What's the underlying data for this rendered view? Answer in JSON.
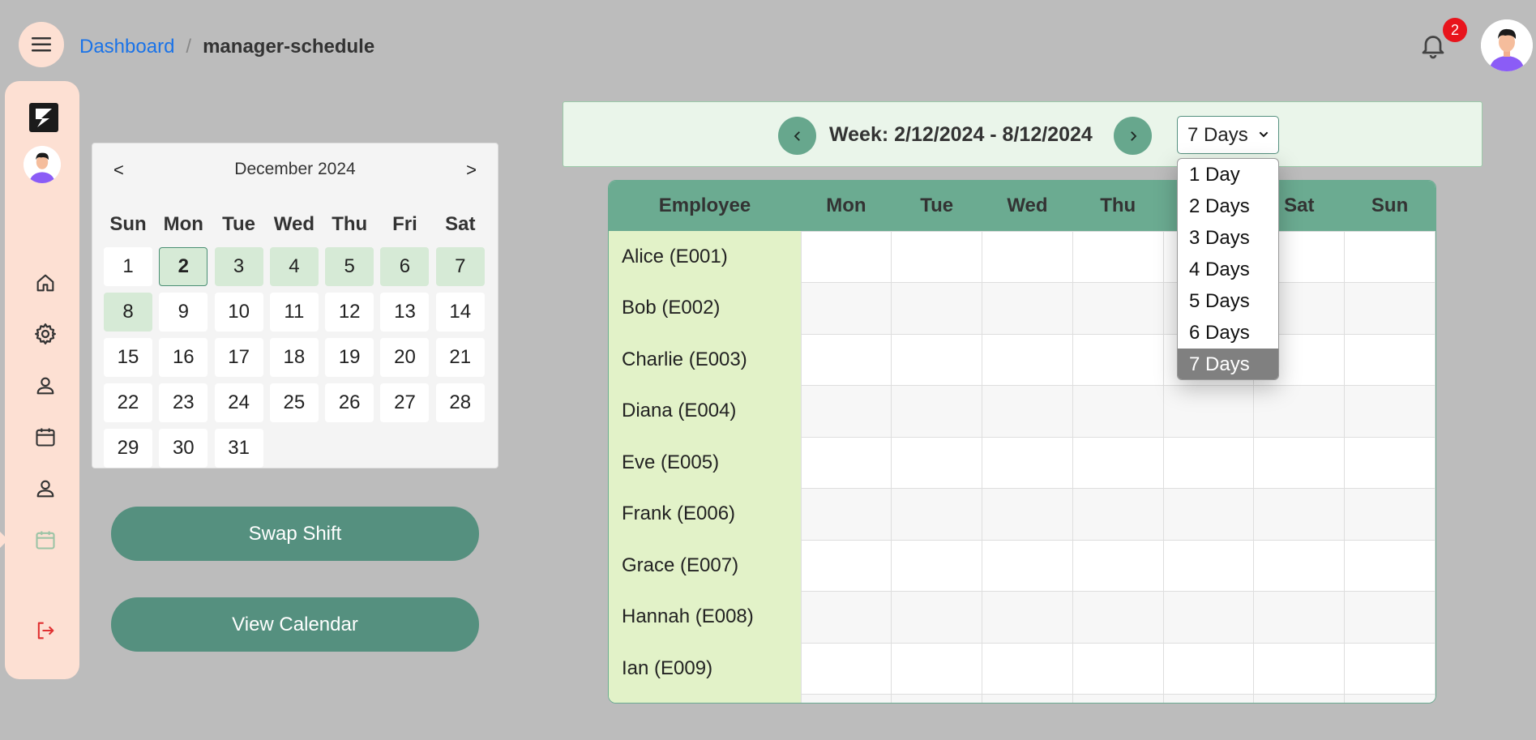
{
  "breadcrumb": {
    "link": "Dashboard",
    "separator": "/",
    "current": "manager-schedule"
  },
  "notifications": {
    "count": "2"
  },
  "mini_calendar": {
    "prev": "<",
    "next": ">",
    "title": "December 2024",
    "weekdays": [
      "Sun",
      "Mon",
      "Tue",
      "Wed",
      "Thu",
      "Fri",
      "Sat"
    ],
    "days": [
      "1",
      "2",
      "3",
      "4",
      "5",
      "6",
      "7",
      "8",
      "9",
      "10",
      "11",
      "12",
      "13",
      "14",
      "15",
      "16",
      "17",
      "18",
      "19",
      "20",
      "21",
      "22",
      "23",
      "24",
      "25",
      "26",
      "27",
      "28",
      "29",
      "30",
      "31"
    ],
    "selected_day": "2",
    "highlighted_week": [
      "2",
      "3",
      "4",
      "5",
      "6",
      "7",
      "8"
    ]
  },
  "buttons": {
    "swap": "Swap Shift",
    "view_calendar": "View Calendar"
  },
  "week": {
    "label": "Week: 2/12/2024 - 8/12/2024"
  },
  "days_select": {
    "value": "7 Days",
    "options": [
      "1 Day",
      "2 Days",
      "3 Days",
      "4 Days",
      "5 Days",
      "6 Days",
      "7 Days"
    ]
  },
  "schedule": {
    "headers": [
      "Employee",
      "Mon",
      "Tue",
      "Wed",
      "Thu",
      "Fri",
      "Sat",
      "Sun"
    ],
    "employees": [
      "Alice (E001)",
      "Bob (E002)",
      "Charlie (E003)",
      "Diana (E004)",
      "Eve (E005)",
      "Frank (E006)",
      "Grace (E007)",
      "Hannah (E008)",
      "Ian (E009)",
      ""
    ]
  },
  "colors": {
    "accent": "#55907f",
    "header": "#6bab91",
    "sidebar": "#fde0d3",
    "link": "#1a73e8",
    "badge": "#e8141c"
  }
}
